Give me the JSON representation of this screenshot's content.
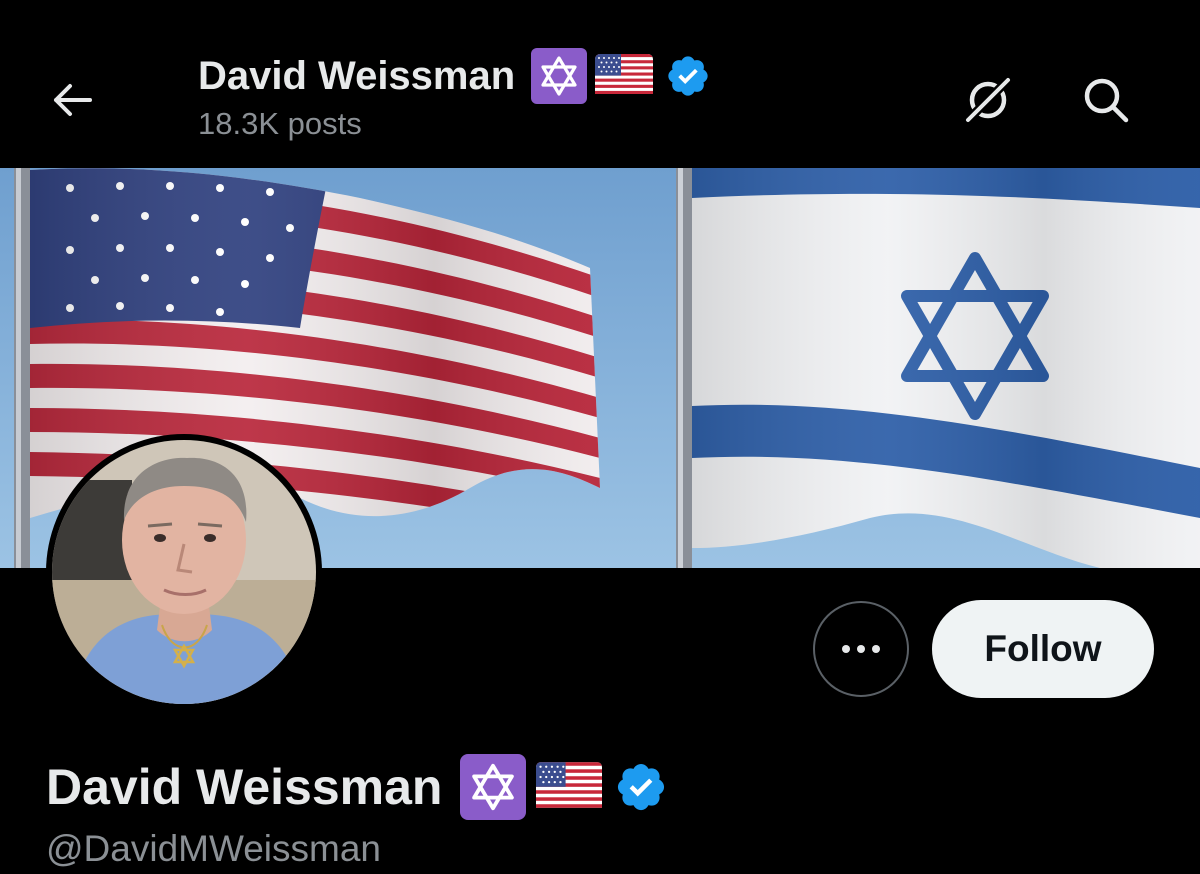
{
  "header": {
    "display_name": "David Weissman",
    "posts_count": "18.3K posts"
  },
  "profile": {
    "display_name": "David Weissman",
    "handle": "@DavidMWeissman",
    "verified": true
  },
  "actions": {
    "follow_label": "Follow",
    "more_label": "More"
  },
  "icons": {
    "back": "arrow-left-icon",
    "grok": "grok-icon",
    "search": "search-icon",
    "star": "star-of-david-icon",
    "flag": "us-flag-icon",
    "verified": "verified-badge-icon"
  },
  "colors": {
    "background": "#000000",
    "text_primary": "#e7e9ea",
    "text_secondary": "#8b9095",
    "verified_blue": "#1d9bf0",
    "star_badge_purple": "#8a5cc9",
    "follow_button_bg": "#eff3f4"
  }
}
